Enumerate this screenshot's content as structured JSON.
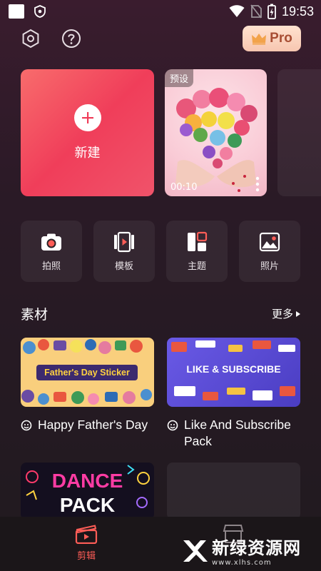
{
  "status_bar": {
    "time": "19:53"
  },
  "header": {
    "pro_label": "Pro"
  },
  "project_cards": {
    "new_label": "新建",
    "preset_tag": "预设",
    "preset_duration": "00:10"
  },
  "tools": [
    {
      "label": "拍照",
      "icon": "camera-icon"
    },
    {
      "label": "模板",
      "icon": "template-icon"
    },
    {
      "label": "主题",
      "icon": "theme-icon"
    },
    {
      "label": "照片",
      "icon": "photo-icon"
    }
  ],
  "materials": {
    "title": "素材",
    "more_label": "更多",
    "items": [
      {
        "banner_text": "Father's Day Sticker",
        "name": "Happy Father's Day"
      },
      {
        "banner_text": "LIKE & SUBSCRIBE",
        "name": "Like And Subscribe Pack"
      },
      {
        "banner_text_1": "DANCE",
        "banner_text_2": "PACK"
      }
    ]
  },
  "bottom_nav": {
    "edit_label": "剪辑"
  },
  "watermark": {
    "title": "新绿资源网",
    "url": "www.xlhs.com"
  },
  "colors": {
    "accent": "#ff5d57",
    "pro_text": "#a84e34",
    "new_card": "#f03e5a"
  }
}
